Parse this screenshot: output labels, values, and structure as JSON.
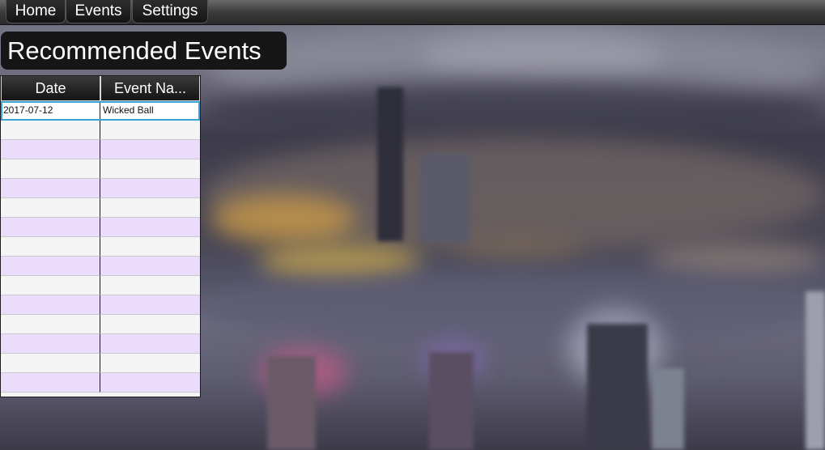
{
  "menu": {
    "items": [
      {
        "label": "Home"
      },
      {
        "label": "Events"
      },
      {
        "label": "Settings"
      }
    ]
  },
  "page": {
    "title": "Recommended Events"
  },
  "table": {
    "columns": [
      "Date",
      "Event Na..."
    ],
    "rows": [
      {
        "date": "2017-07-12",
        "event_name": "Wicked Ball"
      }
    ],
    "empty_row_count": 14
  }
}
